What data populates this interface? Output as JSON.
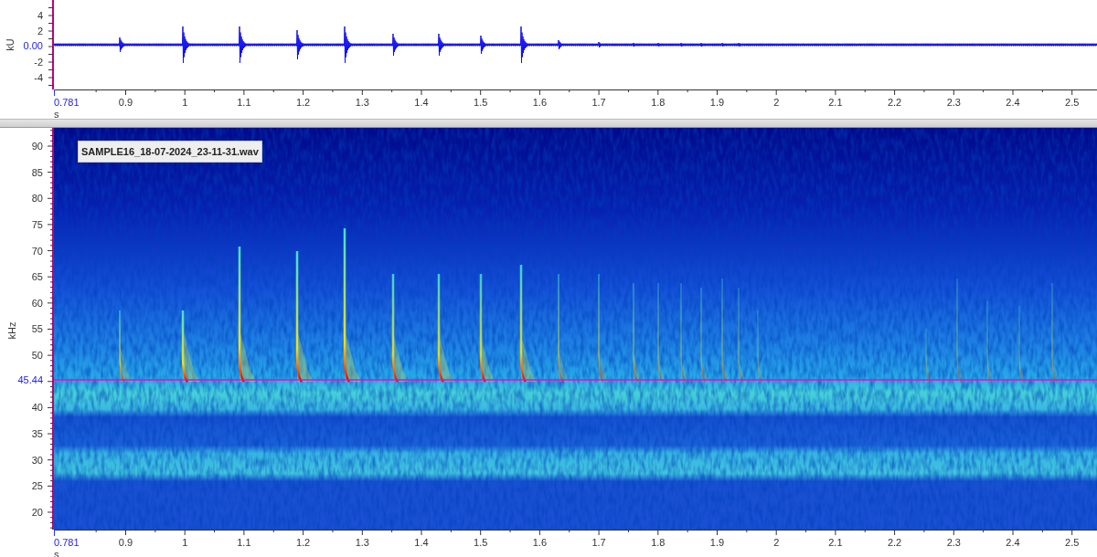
{
  "waveform": {
    "y_unit": "kU",
    "y_ticks": [
      "4",
      "2",
      "-2",
      "-4"
    ],
    "cursor_value": "0.00",
    "x_ticks": [
      "0.781",
      "0.9",
      "1",
      "1.1",
      "1.2",
      "1.3",
      "1.4",
      "1.5",
      "1.6",
      "1.7",
      "1.8",
      "1.9",
      "2",
      "2.1",
      "2.2",
      "2.3",
      "2.4",
      "2.5"
    ],
    "x_unit": "s"
  },
  "spectrogram": {
    "file_label": "SAMPLE16_18-07-2024_23-11-31.wav",
    "y_unit": "kHz",
    "y_ticks": [
      "90",
      "85",
      "80",
      "75",
      "70",
      "65",
      "60",
      "55",
      "50",
      "40",
      "35",
      "30",
      "25",
      "20"
    ],
    "cursor_value": "45.44",
    "x_ticks": [
      "0.781",
      "0.9",
      "1",
      "1.1",
      "1.2",
      "1.3",
      "1.4",
      "1.5",
      "1.6",
      "1.7",
      "1.8",
      "1.9",
      "2",
      "2.1",
      "2.2",
      "2.3",
      "2.4",
      "2.5"
    ],
    "x_unit": "s"
  }
}
